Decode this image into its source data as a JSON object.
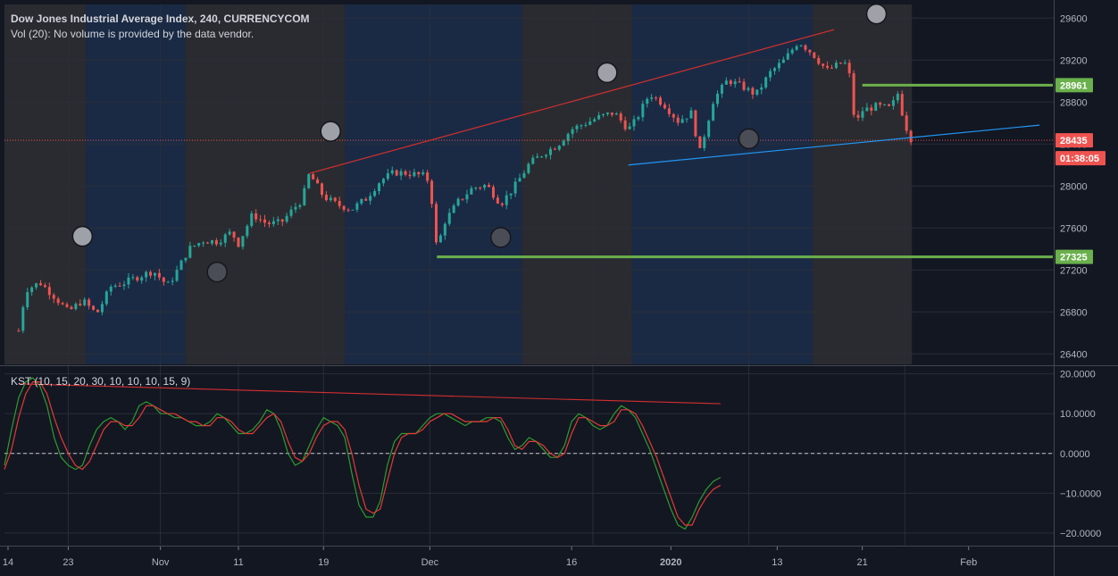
{
  "header": {
    "title": "Dow Jones Industrial Average Index, 240, CURRENCYCOM",
    "volume_note": "Vol (20): No volume is provided by the data vendor."
  },
  "kst_label": "KST (10, 15, 20, 30, 10, 10, 10, 15, 9)",
  "colors": {
    "background": "#131722",
    "band_gray": "#2a2b30",
    "band_blue": "#1a2a44",
    "up": "#26a69a",
    "down": "#ef5350",
    "trend_red": "#d32f2f",
    "trend_blue": "#2196f3",
    "level_green": "#6ab04c",
    "kst_line": "#2e9b2e",
    "kst_signal": "#e53935"
  },
  "chart_data": [
    {
      "type": "candlestick",
      "title": "Dow Jones Industrial Average Index, 240, CURRENCYCOM",
      "x_ticks": [
        "14",
        "23",
        "Nov",
        "11",
        "19",
        "Dec",
        "16",
        "2020",
        "13",
        "21",
        "Feb"
      ],
      "y_ticks": [
        26400,
        26800,
        27200,
        27600,
        28000,
        28400,
        28800,
        29200,
        29600
      ],
      "ylim": [
        26300,
        29730
      ],
      "price_path": [
        [
          14,
          26620
        ],
        [
          15,
          27010
        ],
        [
          17,
          27080
        ],
        [
          19,
          26950
        ],
        [
          21,
          26800
        ],
        [
          23,
          26910
        ],
        [
          25,
          26780
        ],
        [
          27,
          27040
        ],
        [
          29,
          27080
        ],
        [
          31,
          27140
        ],
        [
          33,
          27190
        ],
        [
          35,
          27050
        ],
        [
          36,
          27150
        ],
        [
          38,
          27400
        ],
        [
          40,
          27480
        ],
        [
          42,
          27470
        ],
        [
          44,
          27560
        ],
        [
          45,
          27450
        ],
        [
          47,
          27730
        ],
        [
          49,
          27640
        ],
        [
          51,
          27650
        ],
        [
          53,
          27800
        ],
        [
          54,
          27870
        ],
        [
          55,
          28120
        ],
        [
          57,
          27900
        ],
        [
          59,
          27820
        ],
        [
          61,
          27780
        ],
        [
          63,
          27880
        ],
        [
          65,
          28050
        ],
        [
          67,
          28130
        ],
        [
          69,
          28120
        ],
        [
          71,
          28100
        ],
        [
          72,
          28040
        ],
        [
          73,
          27380
        ],
        [
          74,
          27650
        ],
        [
          76,
          27850
        ],
        [
          78,
          27980
        ],
        [
          80,
          28010
        ],
        [
          82,
          27830
        ],
        [
          84,
          28000
        ],
        [
          86,
          28210
        ],
        [
          88,
          28310
        ],
        [
          90,
          28390
        ],
        [
          92,
          28540
        ],
        [
          94,
          28600
        ],
        [
          96,
          28660
        ],
        [
          98,
          28700
        ],
        [
          100,
          28540
        ],
        [
          101,
          28620
        ],
        [
          103,
          28880
        ],
        [
          105,
          28780
        ],
        [
          107,
          28620
        ],
        [
          109,
          28700
        ],
        [
          110,
          28300
        ],
        [
          112,
          28820
        ],
        [
          114,
          29010
        ],
        [
          116,
          28950
        ],
        [
          118,
          28870
        ],
        [
          120,
          29080
        ],
        [
          122,
          29200
        ],
        [
          124,
          29380
        ],
        [
          126,
          29260
        ],
        [
          128,
          29100
        ],
        [
          130,
          29170
        ],
        [
          131,
          29160
        ],
        [
          132,
          28570
        ],
        [
          133,
          28720
        ],
        [
          135,
          28760
        ],
        [
          137,
          28740
        ],
        [
          138,
          28880
        ],
        [
          139,
          28590
        ],
        [
          140,
          28430
        ]
      ],
      "support_level": 27325,
      "resistance_level": 28961,
      "current_price": 28435,
      "countdown": "01:38:05",
      "price_labels": {
        "support": "27325",
        "resistance": "28961",
        "current": "28435"
      },
      "trendlines": [
        {
          "name": "upper-red",
          "from": [
            55,
            28120
          ],
          "to": [
            129,
            29490
          ]
        },
        {
          "name": "lower-blue",
          "from": [
            100,
            28200
          ],
          "to": [
            158,
            28580
          ]
        }
      ],
      "markers": [
        {
          "x": 23,
          "y": 27520,
          "fill": "gray"
        },
        {
          "x": 42,
          "y": 27180,
          "fill": "dark"
        },
        {
          "x": 58,
          "y": 28520,
          "fill": "gray"
        },
        {
          "x": 82,
          "y": 27510,
          "fill": "dark"
        },
        {
          "x": 97,
          "y": 29080,
          "fill": "gray"
        },
        {
          "x": 117,
          "y": 28450,
          "fill": "dark"
        },
        {
          "x": 135,
          "y": 29640,
          "fill": "gray"
        }
      ]
    },
    {
      "type": "line",
      "title": "KST (10, 15, 20, 30, 10, 10, 10, 15, 9)",
      "y_ticks": [
        "20.0000",
        "10.0000",
        "0.0000",
        "−10.0000",
        "−20.0000"
      ],
      "ylim": [
        -22.5,
        21.5
      ],
      "series": [
        {
          "name": "KST",
          "points": [
            [
              12,
              -3
            ],
            [
              13,
              6
            ],
            [
              14,
              14
            ],
            [
              15,
              18
            ],
            [
              16,
              19
            ],
            [
              17,
              17
            ],
            [
              18,
              12
            ],
            [
              19,
              4
            ],
            [
              20,
              -1
            ],
            [
              21,
              -3
            ],
            [
              22,
              -4
            ],
            [
              23,
              -3
            ],
            [
              24,
              2
            ],
            [
              25,
              6
            ],
            [
              26,
              8
            ],
            [
              27,
              9
            ],
            [
              28,
              8
            ],
            [
              29,
              6
            ],
            [
              30,
              8
            ],
            [
              31,
              12
            ],
            [
              32,
              13
            ],
            [
              33,
              12
            ],
            [
              34,
              10
            ],
            [
              35,
              10
            ],
            [
              36,
              9
            ],
            [
              37,
              9
            ],
            [
              38,
              8
            ],
            [
              39,
              7
            ],
            [
              40,
              7
            ],
            [
              41,
              8
            ],
            [
              42,
              10
            ],
            [
              43,
              9
            ],
            [
              44,
              7
            ],
            [
              45,
              5
            ],
            [
              46,
              5
            ],
            [
              47,
              6
            ],
            [
              48,
              8
            ],
            [
              49,
              11
            ],
            [
              50,
              10
            ],
            [
              51,
              6
            ],
            [
              52,
              0
            ],
            [
              53,
              -3
            ],
            [
              54,
              -2
            ],
            [
              55,
              2
            ],
            [
              56,
              6
            ],
            [
              57,
              9
            ],
            [
              58,
              8
            ],
            [
              59,
              7
            ],
            [
              60,
              4
            ],
            [
              61,
              -5
            ],
            [
              62,
              -13
            ],
            [
              63,
              -16
            ],
            [
              64,
              -16
            ],
            [
              65,
              -12
            ],
            [
              66,
              -3
            ],
            [
              67,
              3
            ],
            [
              68,
              5
            ],
            [
              69,
              5
            ],
            [
              70,
              5
            ],
            [
              71,
              7
            ],
            [
              72,
              9
            ],
            [
              73,
              10
            ],
            [
              74,
              10
            ],
            [
              75,
              9
            ],
            [
              76,
              8
            ],
            [
              77,
              7
            ],
            [
              78,
              8
            ],
            [
              79,
              8
            ],
            [
              80,
              9
            ],
            [
              81,
              9
            ],
            [
              82,
              8
            ],
            [
              83,
              4
            ],
            [
              84,
              1
            ],
            [
              85,
              2
            ],
            [
              86,
              4
            ],
            [
              87,
              3
            ],
            [
              88,
              1
            ],
            [
              89,
              -1
            ],
            [
              90,
              -1
            ],
            [
              91,
              2
            ],
            [
              92,
              8
            ],
            [
              93,
              10
            ],
            [
              94,
              9
            ],
            [
              95,
              7
            ],
            [
              96,
              6
            ],
            [
              97,
              7
            ],
            [
              98,
              10
            ],
            [
              99,
              12
            ],
            [
              100,
              11
            ],
            [
              101,
              9
            ],
            [
              102,
              5
            ],
            [
              103,
              1
            ],
            [
              104,
              -4
            ],
            [
              105,
              -9
            ],
            [
              106,
              -14
            ],
            [
              107,
              -18
            ],
            [
              108,
              -19
            ],
            [
              109,
              -16
            ],
            [
              110,
              -12
            ],
            [
              111,
              -9
            ],
            [
              112,
              -7
            ],
            [
              113,
              -6
            ]
          ]
        },
        {
          "name": "Signal",
          "points": [
            [
              12,
              -4
            ],
            [
              13,
              1
            ],
            [
              14,
              9
            ],
            [
              15,
              15
            ],
            [
              16,
              18
            ],
            [
              17,
              18
            ],
            [
              18,
              15
            ],
            [
              19,
              9
            ],
            [
              20,
              4
            ],
            [
              21,
              0
            ],
            [
              22,
              -3
            ],
            [
              23,
              -4
            ],
            [
              24,
              -2
            ],
            [
              25,
              2
            ],
            [
              26,
              6
            ],
            [
              27,
              8
            ],
            [
              28,
              8
            ],
            [
              29,
              7
            ],
            [
              30,
              7
            ],
            [
              31,
              9
            ],
            [
              32,
              12
            ],
            [
              33,
              12
            ],
            [
              34,
              11
            ],
            [
              35,
              10
            ],
            [
              36,
              10
            ],
            [
              37,
              9
            ],
            [
              38,
              8
            ],
            [
              39,
              8
            ],
            [
              40,
              7
            ],
            [
              41,
              7
            ],
            [
              42,
              9
            ],
            [
              43,
              9
            ],
            [
              44,
              8
            ],
            [
              45,
              6
            ],
            [
              46,
              5
            ],
            [
              47,
              5
            ],
            [
              48,
              7
            ],
            [
              49,
              9
            ],
            [
              50,
              10
            ],
            [
              51,
              8
            ],
            [
              52,
              3
            ],
            [
              53,
              -1
            ],
            [
              54,
              -2
            ],
            [
              55,
              0
            ],
            [
              56,
              4
            ],
            [
              57,
              7
            ],
            [
              58,
              8
            ],
            [
              59,
              8
            ],
            [
              60,
              6
            ],
            [
              61,
              0
            ],
            [
              62,
              -8
            ],
            [
              63,
              -14
            ],
            [
              64,
              -15
            ],
            [
              65,
              -14
            ],
            [
              66,
              -7
            ],
            [
              67,
              0
            ],
            [
              68,
              4
            ],
            [
              69,
              5
            ],
            [
              70,
              5
            ],
            [
              71,
              6
            ],
            [
              72,
              8
            ],
            [
              73,
              9
            ],
            [
              74,
              10
            ],
            [
              75,
              10
            ],
            [
              76,
              9
            ],
            [
              77,
              8
            ],
            [
              78,
              8
            ],
            [
              79,
              8
            ],
            [
              80,
              8
            ],
            [
              81,
              9
            ],
            [
              82,
              9
            ],
            [
              83,
              6
            ],
            [
              84,
              2
            ],
            [
              85,
              1
            ],
            [
              86,
              3
            ],
            [
              87,
              3
            ],
            [
              88,
              2
            ],
            [
              89,
              0
            ],
            [
              90,
              -1
            ],
            [
              91,
              0
            ],
            [
              92,
              5
            ],
            [
              93,
              9
            ],
            [
              94,
              9
            ],
            [
              95,
              8
            ],
            [
              96,
              7
            ],
            [
              97,
              7
            ],
            [
              98,
              8
            ],
            [
              99,
              11
            ],
            [
              100,
              11
            ],
            [
              101,
              10
            ],
            [
              102,
              7
            ],
            [
              103,
              3
            ],
            [
              104,
              -1
            ],
            [
              105,
              -6
            ],
            [
              106,
              -11
            ],
            [
              107,
              -16
            ],
            [
              108,
              -18
            ],
            [
              109,
              -18
            ],
            [
              110,
              -14
            ],
            [
              111,
              -11
            ],
            [
              112,
              -9
            ],
            [
              113,
              -8
            ]
          ]
        }
      ],
      "divergence_line": {
        "from": [
          14,
          17.5
        ],
        "to": [
          113,
          12.5
        ]
      }
    }
  ]
}
